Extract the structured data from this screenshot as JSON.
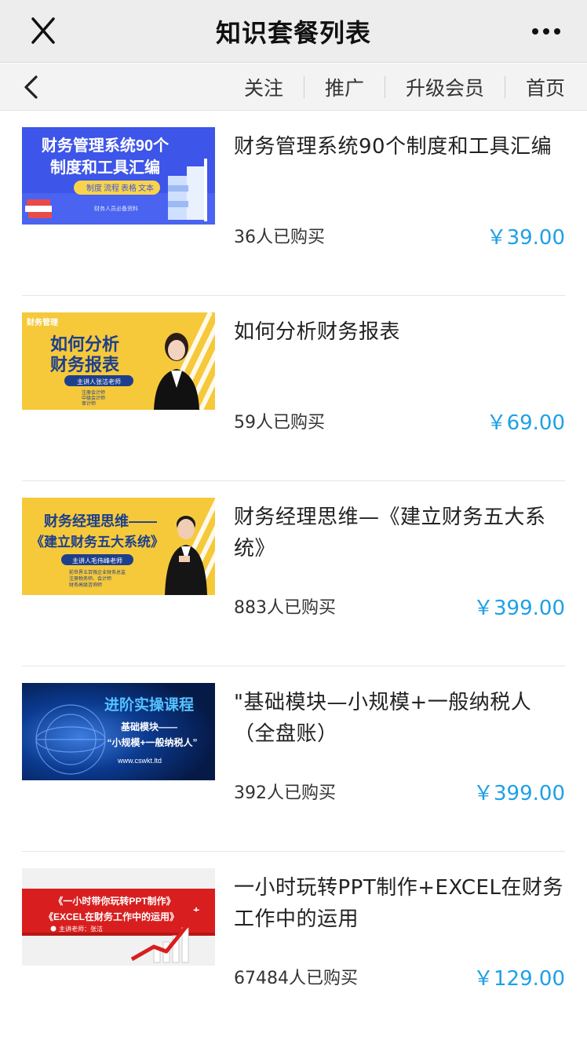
{
  "header": {
    "title": "知识套餐列表"
  },
  "nav": {
    "links": [
      "关注",
      "推广",
      "升级会员",
      "首页"
    ]
  },
  "colors": {
    "price": "#1fa0e6",
    "thumb_blue": "#3d55e8",
    "thumb_yellow": "#f6c93a",
    "thumb_navy": "#0a2f7a",
    "thumb_red": "#d81e1e"
  },
  "items": [
    {
      "name": "财务管理系统90个制度和工具汇编",
      "sold": "36人已购买",
      "price": "￥39.00",
      "thumb": {
        "line1": "财务管理系统90个",
        "line2": "制度和工具汇编",
        "tags": [
          "制度",
          "流程",
          "表格",
          "文本"
        ],
        "footer": "财务人员必备资料"
      }
    },
    {
      "name": "如何分析财务报表",
      "sold": "59人已购买",
      "price": "￥69.00",
      "thumb": {
        "corner": "财务管理",
        "line1": "如何分析",
        "line2": "财务报表",
        "pill": "主讲人张洁老师",
        "bullets": [
          "注册会计师",
          "中级会计师",
          "审计师"
        ]
      }
    },
    {
      "name": "财务经理思维—《建立财务五大系统》",
      "sold": "883人已购买",
      "price": "￥399.00",
      "thumb": {
        "line1": "财务经理思维——",
        "line2": "《建立财务五大系统》",
        "pill": "主讲人毛伟峰老师",
        "bullets": [
          "前世界五百强企业财务总监",
          "注册税务师、会计师",
          "财务高级咨询师"
        ]
      }
    },
    {
      "name": "\"基础模块—小规模+一般纳税人（全盘账）",
      "sold": "392人已购买",
      "price": "￥399.00",
      "thumb": {
        "line1": "进阶实操课程",
        "line2": "基础模块——",
        "line3": "“小规模+一般纳税人”",
        "url": "www.cswkt.ltd"
      }
    },
    {
      "name": "一小时玩转PPT制作+EXCEL在财务工作中的运用",
      "sold": "67484人已购买",
      "price": "￥129.00",
      "thumb": {
        "line1": "《一小时带你玩转PPT制作》",
        "line2": "《EXCEL在财务工作中的运用》",
        "teacher": "主讲老师：张洁"
      }
    }
  ]
}
